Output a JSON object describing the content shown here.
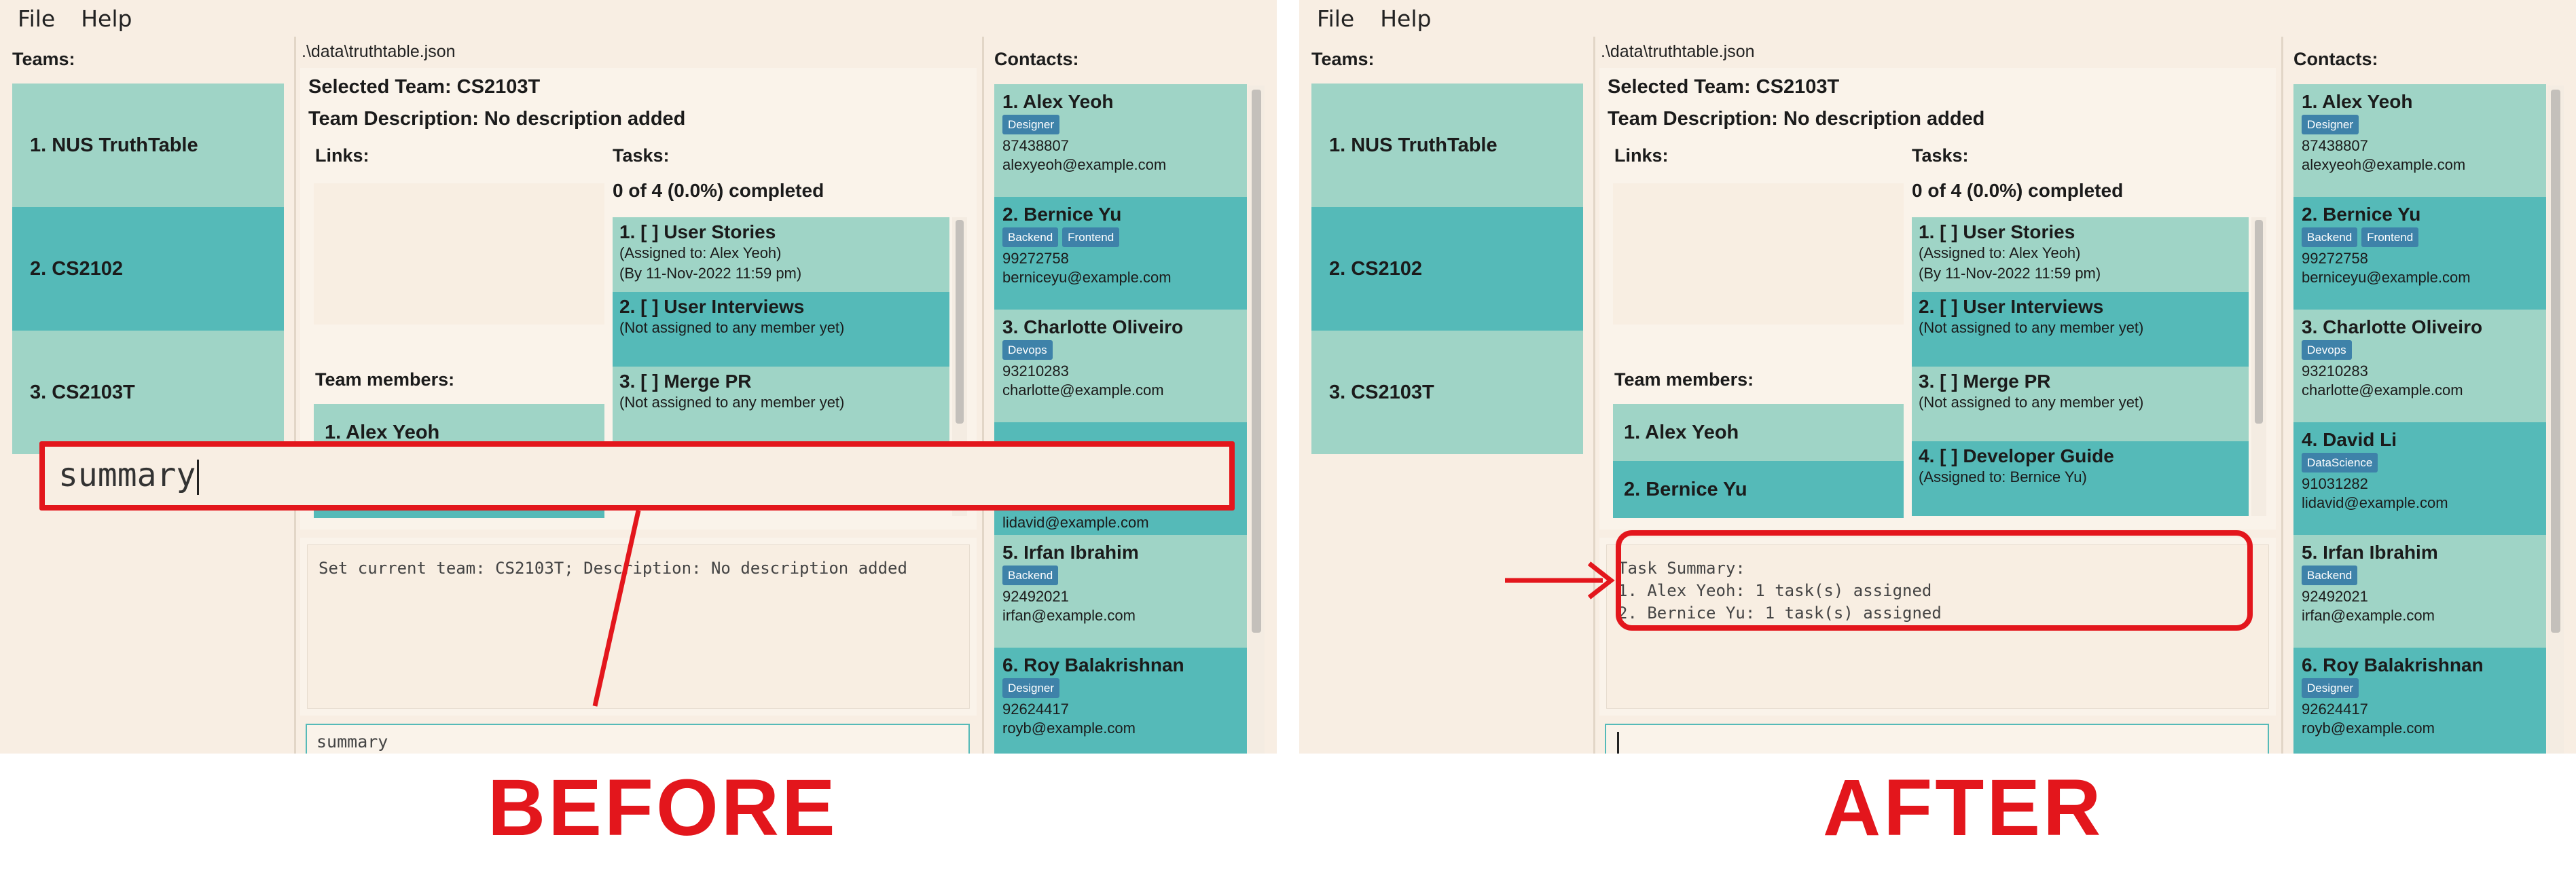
{
  "menu": {
    "file": "File",
    "help": "Help"
  },
  "labels": {
    "before": "BEFORE",
    "after": "AFTER"
  },
  "colors": {
    "accent": "#e3161c",
    "card_light": "#9fd4c6",
    "card_dark": "#55bab8",
    "tag": "#3e82a9",
    "background": "#f8eee3"
  },
  "icons": {
    "arrow": "right-arrow-icon"
  },
  "before": {
    "teams_heading": "Teams:",
    "teams": [
      "1. NUS TruthTable",
      "2. CS2102",
      "3. CS2103T"
    ],
    "file_path": ".\\data\\truthtable.json",
    "selected_team": "Selected Team: CS2103T",
    "team_description": "Team Description: No description added",
    "links_label": "Links:",
    "tasks_label": "Tasks:",
    "tasks_progress": "0 of 4 (0.0%) completed",
    "tasks": [
      {
        "title": "1. [ ] User Stories",
        "line1": "(Assigned to: Alex Yeoh)",
        "line2": "(By 11-Nov-2022 11:59 pm)"
      },
      {
        "title": "2. [ ] User Interviews",
        "line1": "(Not assigned to any member yet)",
        "line2": ""
      },
      {
        "title": "3. [ ] Merge PR",
        "line1": "(Not assigned to any member yet)",
        "line2": ""
      }
    ],
    "members_label": "Team members:",
    "members": [
      "1. Alex Yeoh"
    ],
    "result": "Set current team: CS2103T; Description: No description added",
    "command_value": "summary",
    "overlay_command": "summary",
    "contacts_heading": "Contacts:",
    "contacts": [
      {
        "name": "1. Alex Yeoh",
        "tags": [
          "Designer"
        ],
        "phone": "87438807",
        "email": "alexyeoh@example.com"
      },
      {
        "name": "2. Bernice Yu",
        "tags": [
          "Backend",
          "Frontend"
        ],
        "phone": "99272758",
        "email": "berniceyu@example.com"
      },
      {
        "name": "3. Charlotte Oliveiro",
        "tags": [
          "Devops"
        ],
        "phone": "93210283",
        "email": "charlotte@example.com"
      },
      {
        "name": "",
        "tags": [],
        "phone": "",
        "email": "lidavid@example.com"
      },
      {
        "name": "5. Irfan Ibrahim",
        "tags": [
          "Backend"
        ],
        "phone": "92492021",
        "email": "irfan@example.com"
      },
      {
        "name": "6. Roy Balakrishnan",
        "tags": [
          "Designer"
        ],
        "phone": "92624417",
        "email": "royb@example.com"
      }
    ]
  },
  "after": {
    "teams_heading": "Teams:",
    "teams": [
      "1. NUS TruthTable",
      "2. CS2102",
      "3. CS2103T"
    ],
    "file_path": ".\\data\\truthtable.json",
    "selected_team": "Selected Team: CS2103T",
    "team_description": "Team Description: No description added",
    "links_label": "Links:",
    "tasks_label": "Tasks:",
    "tasks_progress": "0 of 4 (0.0%) completed",
    "tasks": [
      {
        "title": "1. [ ] User Stories",
        "line1": "(Assigned to: Alex Yeoh)",
        "line2": "(By 11-Nov-2022 11:59 pm)"
      },
      {
        "title": "2. [ ] User Interviews",
        "line1": "(Not assigned to any member yet)",
        "line2": ""
      },
      {
        "title": "3. [ ] Merge PR",
        "line1": "(Not assigned to any member yet)",
        "line2": ""
      },
      {
        "title": "4. [ ] Developer Guide",
        "line1": "(Assigned to: Bernice Yu)",
        "line2": ""
      }
    ],
    "members_label": "Team members:",
    "members": [
      "1. Alex Yeoh",
      "2. Bernice Yu"
    ],
    "result": "Task Summary:\n1. Alex Yeoh: 1 task(s) assigned\n2. Bernice Yu: 1 task(s) assigned",
    "command_value": "",
    "contacts_heading": "Contacts:",
    "contacts": [
      {
        "name": "1. Alex Yeoh",
        "tags": [
          "Designer"
        ],
        "phone": "87438807",
        "email": "alexyeoh@example.com"
      },
      {
        "name": "2. Bernice Yu",
        "tags": [
          "Backend",
          "Frontend"
        ],
        "phone": "99272758",
        "email": "berniceyu@example.com"
      },
      {
        "name": "3. Charlotte Oliveiro",
        "tags": [
          "Devops"
        ],
        "phone": "93210283",
        "email": "charlotte@example.com"
      },
      {
        "name": "4. David Li",
        "tags": [
          "DataScience"
        ],
        "phone": "91031282",
        "email": "lidavid@example.com"
      },
      {
        "name": "5. Irfan Ibrahim",
        "tags": [
          "Backend"
        ],
        "phone": "92492021",
        "email": "irfan@example.com"
      },
      {
        "name": "6. Roy Balakrishnan",
        "tags": [
          "Designer"
        ],
        "phone": "92624417",
        "email": "royb@example.com"
      }
    ]
  }
}
